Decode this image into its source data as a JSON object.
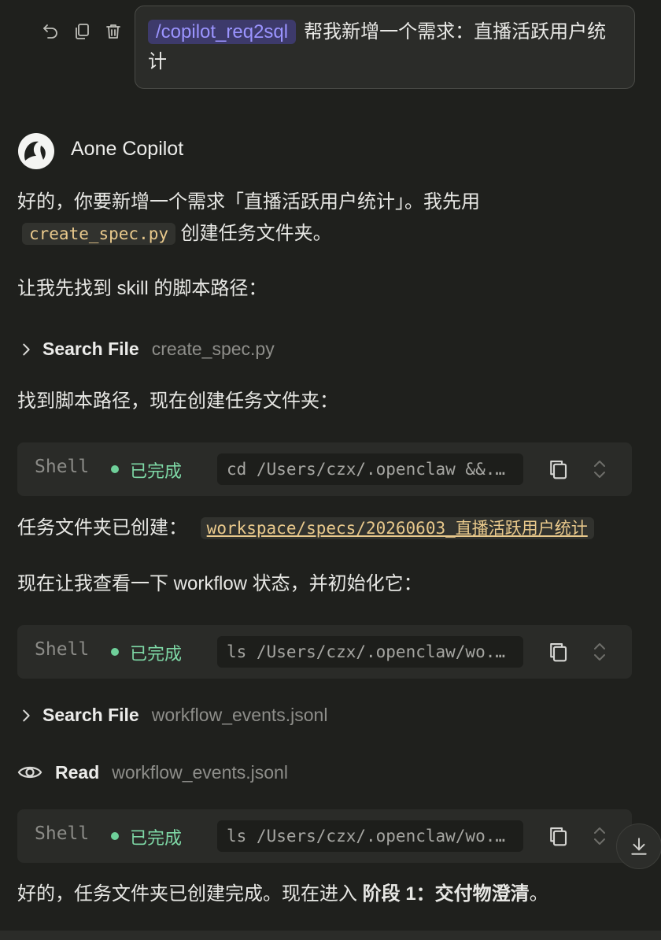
{
  "user_message": {
    "command_tag": "/copilot_req2sql",
    "text": "帮我新增一个需求：直播活跃用户统计"
  },
  "assistant": {
    "name": "Aone Copilot",
    "intro_text_1": "好的，你要新增一个需求「直播活跃用户统计」。我先用",
    "intro_code": "create_spec.py",
    "intro_text_2": " 创建任务文件夹。",
    "find_skill_text": "让我先找到 skill 的脚本路径：",
    "search_1": {
      "label": "Search File",
      "target": "create_spec.py"
    },
    "found_text": "找到脚本路径，现在创建任务文件夹：",
    "shell_1": {
      "label": "Shell",
      "status": "已完成",
      "command": "cd /Users/czx/.openclaw &&..."
    },
    "created_text": "任务文件夹已创建：",
    "created_path": "workspace/specs/20260603_直播活跃用户统计",
    "workflow_text": "现在让我查看一下 workflow 状态，并初始化它：",
    "shell_2": {
      "label": "Shell",
      "status": "已完成",
      "command": "ls /Users/czx/.openclaw/wo..."
    },
    "search_2": {
      "label": "Search File",
      "target": "workflow_events.jsonl"
    },
    "read_1": {
      "label": "Read",
      "target": "workflow_events.jsonl"
    },
    "shell_3": {
      "label": "Shell",
      "status": "已完成",
      "command": "ls /Users/czx/.openclaw/wo..."
    },
    "final_text_1": "好的，任务文件夹已创建完成。现在进入 ",
    "final_bold": "阶段 1：交付物澄清",
    "final_text_2": "。"
  },
  "icons": {
    "undo": "undo-icon",
    "copy": "copy-icon",
    "delete": "trash-icon",
    "chevron": "chevron-right-icon",
    "eye": "eye-icon",
    "expand": "expand-collapse-icon",
    "scroll_down": "arrow-down-icon"
  },
  "colors": {
    "accent_tag": "#9b94ff",
    "status_done": "#7ed8a6",
    "code_text": "#e9c98c"
  }
}
